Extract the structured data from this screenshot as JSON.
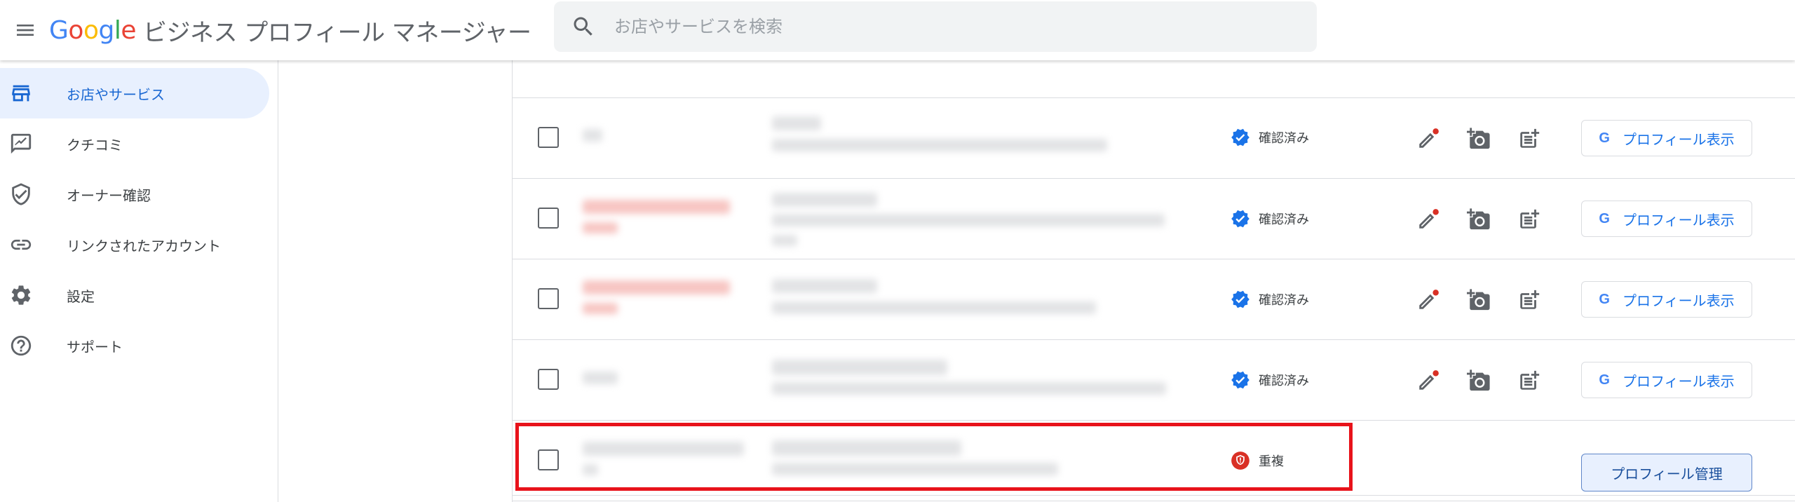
{
  "header": {
    "menu_icon": "hamburger-menu-icon",
    "logo_letters": [
      "G",
      "o",
      "o",
      "g",
      "l",
      "e"
    ],
    "product_name": "ビジネス プロフィール マネージャー",
    "search_placeholder": "お店やサービスを検索"
  },
  "sidebar": {
    "items": [
      {
        "label": "お店やサービス",
        "icon": "store-icon",
        "active": true
      },
      {
        "label": "クチコミ",
        "icon": "review-icon",
        "active": false
      },
      {
        "label": "オーナー確認",
        "icon": "verified-shield-icon",
        "active": false
      },
      {
        "label": "リンクされたアカウント",
        "icon": "link-icon",
        "active": false
      },
      {
        "label": "設定",
        "icon": "gear-icon",
        "active": false
      },
      {
        "label": "サポート",
        "icon": "help-icon",
        "active": false
      }
    ]
  },
  "table": {
    "rows": [
      {
        "status": "確認済み",
        "status_type": "verified",
        "button": "プロフィール表示",
        "button_type": "view"
      },
      {
        "status": "確認済み",
        "status_type": "verified",
        "button": "プロフィール表示",
        "button_type": "view"
      },
      {
        "status": "確認済み",
        "status_type": "verified",
        "button": "プロフィール表示",
        "button_type": "view"
      },
      {
        "status": "確認済み",
        "status_type": "verified",
        "button": "プロフィール表示",
        "button_type": "view"
      },
      {
        "status": "重複",
        "status_type": "duplicate",
        "button": "プロフィール管理",
        "button_type": "manage"
      }
    ]
  },
  "colors": {
    "accent_blue": "#1a73e8",
    "verified_blue": "#1a73e8",
    "duplicate_red": "#d93025",
    "highlight_red": "#e8131b",
    "active_nav_bg": "#e8f0fe"
  }
}
